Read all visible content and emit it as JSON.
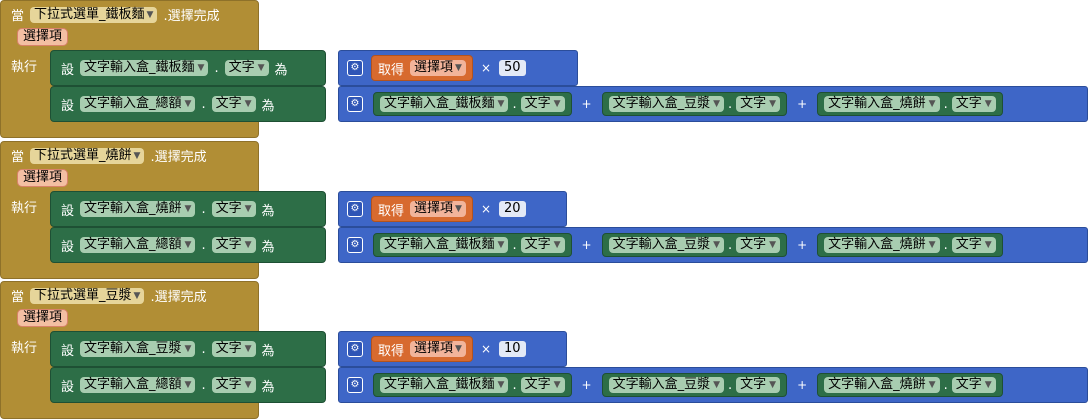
{
  "events": [
    {
      "when": "當",
      "component": "下拉式選單_鐵板麵",
      "event": ".選擇完成",
      "param": "選擇項",
      "do": "執行",
      "stmts": [
        {
          "set": "設",
          "target": "文字輸入盒_鐵板麵",
          "prop": "文字",
          "to": "為",
          "kind": "mul",
          "get": "取得",
          "getvar": "選擇項",
          "op": "×",
          "num": "50"
        },
        {
          "set": "設",
          "target": "文字輸入盒_總額",
          "prop": "文字",
          "to": "為",
          "kind": "sum",
          "terms": [
            {
              "comp": "文字輸入盒_鐵板麵",
              "prop": "文字"
            },
            {
              "comp": "文字輸入盒_豆漿",
              "prop": "文字"
            },
            {
              "comp": "文字輸入盒_燒餅",
              "prop": "文字"
            }
          ],
          "op": "+"
        }
      ]
    },
    {
      "when": "當",
      "component": "下拉式選單_燒餅",
      "event": ".選擇完成",
      "param": "選擇項",
      "do": "執行",
      "stmts": [
        {
          "set": "設",
          "target": "文字輸入盒_燒餅",
          "prop": "文字",
          "to": "為",
          "kind": "mul",
          "get": "取得",
          "getvar": "選擇項",
          "op": "×",
          "num": "20"
        },
        {
          "set": "設",
          "target": "文字輸入盒_總額",
          "prop": "文字",
          "to": "為",
          "kind": "sum",
          "terms": [
            {
              "comp": "文字輸入盒_鐵板麵",
              "prop": "文字"
            },
            {
              "comp": "文字輸入盒_豆漿",
              "prop": "文字"
            },
            {
              "comp": "文字輸入盒_燒餅",
              "prop": "文字"
            }
          ],
          "op": "+"
        }
      ]
    },
    {
      "when": "當",
      "component": "下拉式選單_豆漿",
      "event": ".選擇完成",
      "param": "選擇項",
      "do": "執行",
      "stmts": [
        {
          "set": "設",
          "target": "文字輸入盒_豆漿",
          "prop": "文字",
          "to": "為",
          "kind": "mul",
          "get": "取得",
          "getvar": "選擇項",
          "op": "×",
          "num": "10"
        },
        {
          "set": "設",
          "target": "文字輸入盒_總額",
          "prop": "文字",
          "to": "為",
          "kind": "sum",
          "terms": [
            {
              "comp": "文字輸入盒_鐵板麵",
              "prop": "文字"
            },
            {
              "comp": "文字輸入盒_豆漿",
              "prop": "文字"
            },
            {
              "comp": "文字輸入盒_燒餅",
              "prop": "文字"
            }
          ],
          "op": "+"
        }
      ]
    }
  ]
}
